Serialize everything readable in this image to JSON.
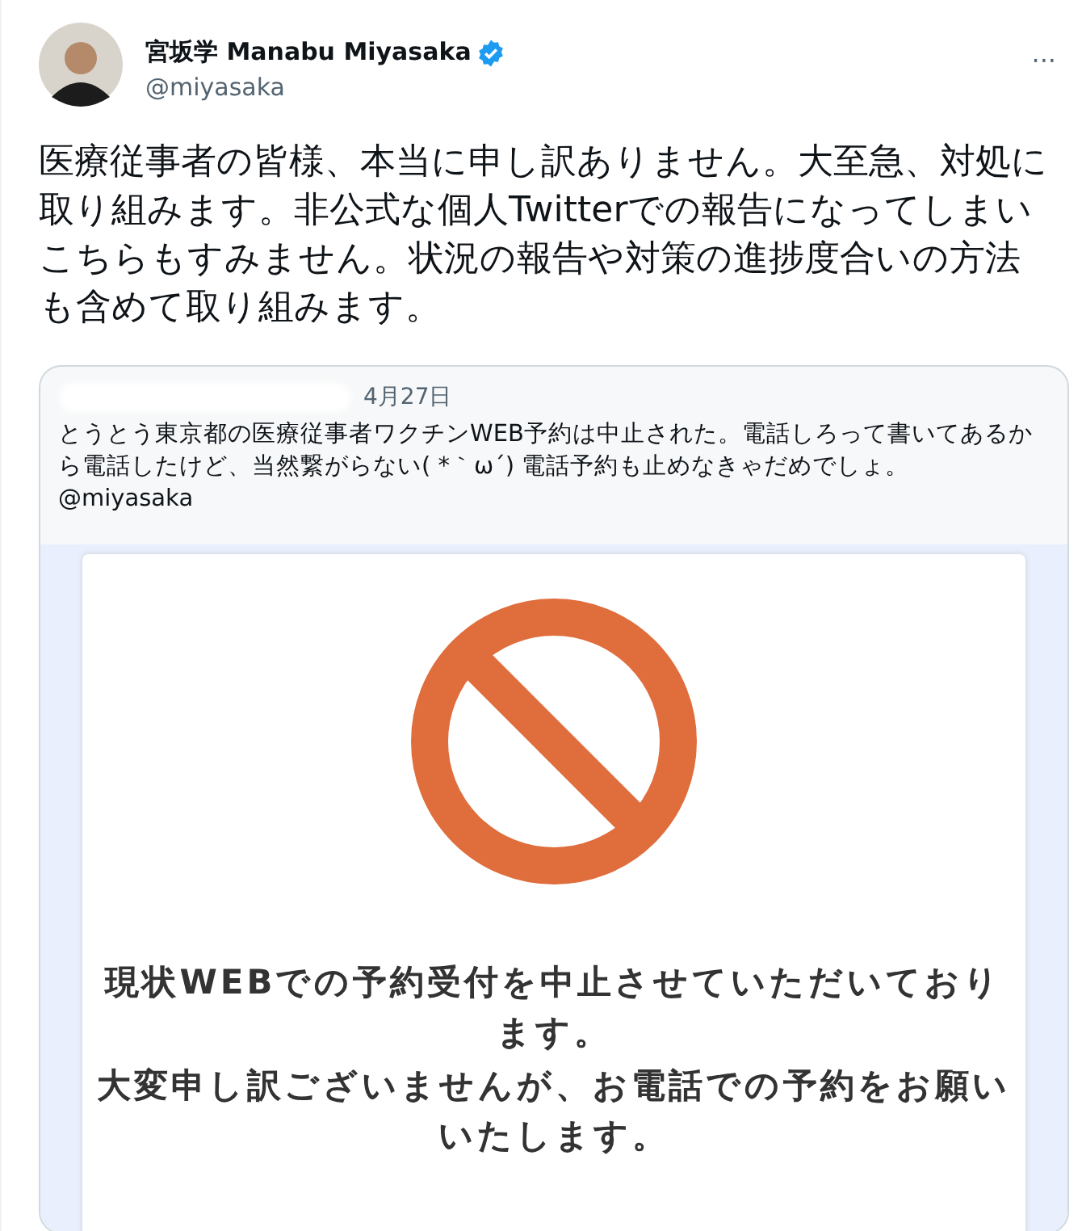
{
  "author": {
    "name": "宮坂学 Manabu Miyasaka",
    "handle": "@miyasaka",
    "verified": true
  },
  "more_menu": "···",
  "text": "医療従事者の皆様、本当に申し訳ありません。大至急、対処に取り組みます。非公式な個人Twitterでの報告になってしまいこちらもすみません。状況の報告や対策の進捗度合いの方法も含めて取り組みます。",
  "quoted_tweet": {
    "date": "4月27日",
    "text": "とうとう東京都の医療従事者ワクチンWEB予約は中止された。電話しろって書いてあるから電話したけど、当然繋がらない( *｀ω´) 電話予約も止めなきゃだめでしょ。",
    "mention": "@miyasaka",
    "notice": {
      "lines": [
        "現状WEBでの予約受付を中止させていただいております。",
        "大変申し訳ございませんが、お電話での予約をお願いいたします。"
      ]
    }
  }
}
